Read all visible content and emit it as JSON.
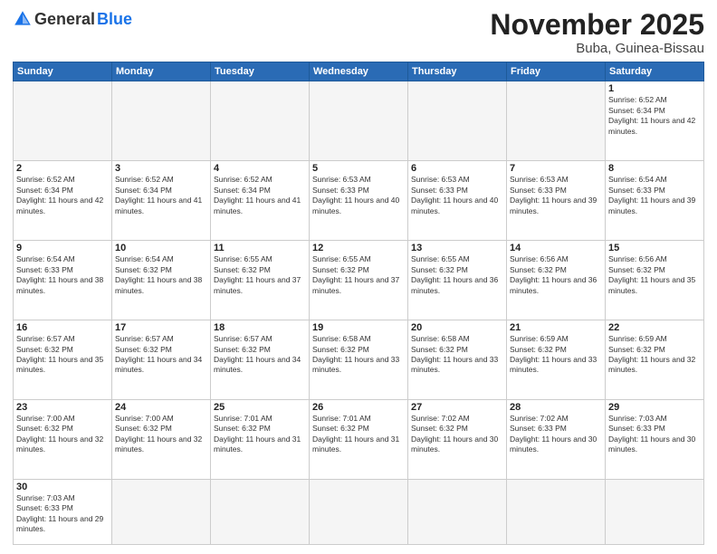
{
  "header": {
    "logo_general": "General",
    "logo_blue": "Blue",
    "month_title": "November 2025",
    "location": "Buba, Guinea-Bissau"
  },
  "weekdays": [
    "Sunday",
    "Monday",
    "Tuesday",
    "Wednesday",
    "Thursday",
    "Friday",
    "Saturday"
  ],
  "days": {
    "1": {
      "sunrise": "6:52 AM",
      "sunset": "6:34 PM",
      "daylight": "11 hours and 42 minutes."
    },
    "2": {
      "sunrise": "6:52 AM",
      "sunset": "6:34 PM",
      "daylight": "11 hours and 42 minutes."
    },
    "3": {
      "sunrise": "6:52 AM",
      "sunset": "6:34 PM",
      "daylight": "11 hours and 41 minutes."
    },
    "4": {
      "sunrise": "6:52 AM",
      "sunset": "6:34 PM",
      "daylight": "11 hours and 41 minutes."
    },
    "5": {
      "sunrise": "6:53 AM",
      "sunset": "6:33 PM",
      "daylight": "11 hours and 40 minutes."
    },
    "6": {
      "sunrise": "6:53 AM",
      "sunset": "6:33 PM",
      "daylight": "11 hours and 40 minutes."
    },
    "7": {
      "sunrise": "6:53 AM",
      "sunset": "6:33 PM",
      "daylight": "11 hours and 39 minutes."
    },
    "8": {
      "sunrise": "6:54 AM",
      "sunset": "6:33 PM",
      "daylight": "11 hours and 39 minutes."
    },
    "9": {
      "sunrise": "6:54 AM",
      "sunset": "6:33 PM",
      "daylight": "11 hours and 38 minutes."
    },
    "10": {
      "sunrise": "6:54 AM",
      "sunset": "6:32 PM",
      "daylight": "11 hours and 38 minutes."
    },
    "11": {
      "sunrise": "6:55 AM",
      "sunset": "6:32 PM",
      "daylight": "11 hours and 37 minutes."
    },
    "12": {
      "sunrise": "6:55 AM",
      "sunset": "6:32 PM",
      "daylight": "11 hours and 37 minutes."
    },
    "13": {
      "sunrise": "6:55 AM",
      "sunset": "6:32 PM",
      "daylight": "11 hours and 36 minutes."
    },
    "14": {
      "sunrise": "6:56 AM",
      "sunset": "6:32 PM",
      "daylight": "11 hours and 36 minutes."
    },
    "15": {
      "sunrise": "6:56 AM",
      "sunset": "6:32 PM",
      "daylight": "11 hours and 35 minutes."
    },
    "16": {
      "sunrise": "6:57 AM",
      "sunset": "6:32 PM",
      "daylight": "11 hours and 35 minutes."
    },
    "17": {
      "sunrise": "6:57 AM",
      "sunset": "6:32 PM",
      "daylight": "11 hours and 34 minutes."
    },
    "18": {
      "sunrise": "6:57 AM",
      "sunset": "6:32 PM",
      "daylight": "11 hours and 34 minutes."
    },
    "19": {
      "sunrise": "6:58 AM",
      "sunset": "6:32 PM",
      "daylight": "11 hours and 33 minutes."
    },
    "20": {
      "sunrise": "6:58 AM",
      "sunset": "6:32 PM",
      "daylight": "11 hours and 33 minutes."
    },
    "21": {
      "sunrise": "6:59 AM",
      "sunset": "6:32 PM",
      "daylight": "11 hours and 33 minutes."
    },
    "22": {
      "sunrise": "6:59 AM",
      "sunset": "6:32 PM",
      "daylight": "11 hours and 32 minutes."
    },
    "23": {
      "sunrise": "7:00 AM",
      "sunset": "6:32 PM",
      "daylight": "11 hours and 32 minutes."
    },
    "24": {
      "sunrise": "7:00 AM",
      "sunset": "6:32 PM",
      "daylight": "11 hours and 32 minutes."
    },
    "25": {
      "sunrise": "7:01 AM",
      "sunset": "6:32 PM",
      "daylight": "11 hours and 31 minutes."
    },
    "26": {
      "sunrise": "7:01 AM",
      "sunset": "6:32 PM",
      "daylight": "11 hours and 31 minutes."
    },
    "27": {
      "sunrise": "7:02 AM",
      "sunset": "6:32 PM",
      "daylight": "11 hours and 30 minutes."
    },
    "28": {
      "sunrise": "7:02 AM",
      "sunset": "6:33 PM",
      "daylight": "11 hours and 30 minutes."
    },
    "29": {
      "sunrise": "7:03 AM",
      "sunset": "6:33 PM",
      "daylight": "11 hours and 30 minutes."
    },
    "30": {
      "sunrise": "7:03 AM",
      "sunset": "6:33 PM",
      "daylight": "11 hours and 29 minutes."
    }
  }
}
